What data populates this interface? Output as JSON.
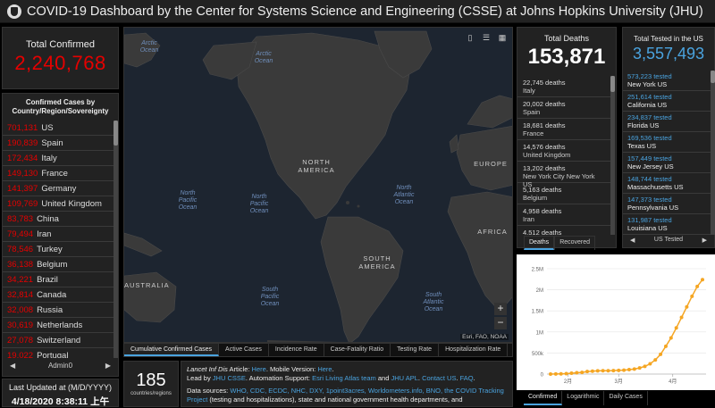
{
  "header": {
    "title": "COVID-19 Dashboard by the Center for Systems Science and Engineering (CSSE) at Johns Hopkins University (JHU)",
    "logo": "jhu-shield-logo"
  },
  "total_confirmed": {
    "label": "Total Confirmed",
    "value": "2,240,768"
  },
  "confirmed_list": {
    "header": "Confirmed Cases by Country/Region/Sovereignty",
    "rows": [
      {
        "value": "701,131",
        "name": "US"
      },
      {
        "value": "190,839",
        "name": "Spain"
      },
      {
        "value": "172,434",
        "name": "Italy"
      },
      {
        "value": "149,130",
        "name": "France"
      },
      {
        "value": "141,397",
        "name": "Germany"
      },
      {
        "value": "109,769",
        "name": "United Kingdom"
      },
      {
        "value": "83,783",
        "name": "China"
      },
      {
        "value": "79,494",
        "name": "Iran"
      },
      {
        "value": "78,546",
        "name": "Turkey"
      },
      {
        "value": "36,138",
        "name": "Belgium"
      },
      {
        "value": "34,221",
        "name": "Brazil"
      },
      {
        "value": "32,814",
        "name": "Canada"
      },
      {
        "value": "32,008",
        "name": "Russia"
      },
      {
        "value": "30,619",
        "name": "Netherlands"
      },
      {
        "value": "27,078",
        "name": "Switzerland"
      },
      {
        "value": "19,022",
        "name": "Portugal"
      }
    ],
    "footer": "Admin0"
  },
  "last_updated": {
    "label": "Last Updated at (M/D/YYYY)",
    "value": "4/18/2020 8:38:11 上午"
  },
  "map": {
    "labels": {
      "arctic1": "Arctic Ocean",
      "arctic2": "Arctic Ocean",
      "npac1": "North Pacific Ocean",
      "npac2": "North Pacific Ocean",
      "natl": "North Atlantic Ocean",
      "spac": "South Pacific Ocean",
      "satl": "South Atlantic Ocean",
      "namerica": "NORTH AMERICA",
      "samerica": "SOUTH AMERICA",
      "europe": "EUROPE",
      "africa": "AFRICA",
      "australia": "AUSTRALIA"
    },
    "attribution": "Esri, FAO, NOAA",
    "tabs": [
      "Cumulative Confirmed Cases",
      "Active Cases",
      "Incidence Rate",
      "Case-Fatality Ratio",
      "Testing Rate",
      "Hospitalization Rate"
    ]
  },
  "countries_count": {
    "value": "185",
    "label": "countries/regions"
  },
  "info": {
    "line1_italic": "Lancet Inf Dis",
    "line1": " Article: ",
    "here1": "Here",
    "mobile": ". Mobile Version: ",
    "here2": "Here",
    "dot": ".",
    "lead_prefix": "Lead by ",
    "lead": "JHU CSSE",
    "auto": ". Automation Support: ",
    "esri": "Esri Living Atlas team",
    "and": " and ",
    "apl": "JHU APL",
    "contact_sep": ". ",
    "contact": "Contact US",
    "faq_sep": ". ",
    "faq": "FAQ",
    "end": ".",
    "sources_prefix": "Data sources: ",
    "sources": "WHO, CDC, ECDC, NHC, DXY, 1point3acres, Worldometers.info, BNO, the COVID Tracking Project",
    "sources_tail": " (testing and hospitalizations), state and national government health departments, and"
  },
  "deaths": {
    "label": "Total Deaths",
    "value": "153,871",
    "rows": [
      {
        "line": "22,745 deaths",
        "sub": "Italy"
      },
      {
        "line": "20,002 deaths",
        "sub": "Spain"
      },
      {
        "line": "18,681 deaths",
        "sub": "France"
      },
      {
        "line": "14,576 deaths",
        "sub": "United Kingdom"
      },
      {
        "line": "13,202 deaths",
        "sub": "New York City New York US"
      },
      {
        "line": "5,163 deaths",
        "sub": "Belgium"
      },
      {
        "line": "4,958 deaths",
        "sub": "Iran"
      },
      {
        "line": "4,512 deaths",
        "sub": ""
      }
    ],
    "tabs": [
      "Deaths",
      "Recovered"
    ]
  },
  "tested": {
    "label": "Total Tested in the US",
    "value": "3,557,493",
    "rows": [
      {
        "value": "573,223 tested",
        "sub": "New York US"
      },
      {
        "value": "251,614 tested",
        "sub": "California US"
      },
      {
        "value": "234,837 tested",
        "sub": "Florida US"
      },
      {
        "value": "169,536 tested",
        "sub": "Texas US"
      },
      {
        "value": "157,449 tested",
        "sub": "New Jersey US"
      },
      {
        "value": "148,744 tested",
        "sub": "Massachusetts US"
      },
      {
        "value": "147,373 tested",
        "sub": "Pennsylvania US"
      },
      {
        "value": "131,987 tested",
        "sub": "Louisiana US"
      }
    ],
    "footer": "US Tested"
  },
  "chart_tabs": [
    "Confirmed",
    "Logarithmic",
    "Daily Cases"
  ],
  "colors": {
    "confirmed": "#e60000",
    "accent": "#4aa3df",
    "chart_line": "#f5a623"
  },
  "chart_data": {
    "type": "line",
    "title": "",
    "xlabel": "",
    "ylabel": "",
    "x_ticks": [
      "2月",
      "3月",
      "4月"
    ],
    "y_ticks": [
      "0",
      "500k",
      "1M",
      "1.5M",
      "2M",
      "2.5M"
    ],
    "ylim": [
      0,
      2500000
    ],
    "x": [
      "1/22",
      "1/25",
      "1/28",
      "1/31",
      "2/3",
      "2/6",
      "2/9",
      "2/12",
      "2/15",
      "2/18",
      "2/21",
      "2/24",
      "2/27",
      "3/1",
      "3/4",
      "3/7",
      "3/10",
      "3/13",
      "3/16",
      "3/19",
      "3/22",
      "3/25",
      "3/28",
      "3/31",
      "4/3",
      "4/6",
      "4/9",
      "4/12",
      "4/15",
      "4/18"
    ],
    "series": [
      {
        "values": [
          555,
          2118,
          5578,
          9927,
          19881,
          31481,
          40553,
          60092,
          69032,
          75641,
          78572,
          80415,
          83112,
          87934,
          93090,
          105835,
          119239,
          145193,
          181546,
          242713,
          336004,
          467653,
          660706,
          857487,
          1095917,
          1345048,
          1595350,
          1846680,
          2078605,
          2240768
        ]
      }
    ]
  }
}
